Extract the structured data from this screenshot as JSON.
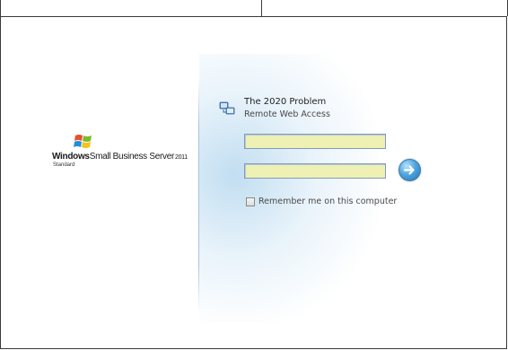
{
  "brand": {
    "name_part1": "Windows",
    "name_part2": "Small Business Server",
    "year": "2011",
    "edition": "Standard",
    "logo_icon": "windows-flag-icon"
  },
  "login": {
    "app_icon": "remote-web-access-icon",
    "site_title": "The 2020 Problem",
    "site_subtitle": "Remote Web Access",
    "username_value": "",
    "password_value": "",
    "submit_icon": "arrow-right-icon",
    "remember_label": "Remember me on this computer",
    "remember_checked": false
  },
  "colors": {
    "field_background": "#eef0b4",
    "field_border": "#7f9db9",
    "button_blue": "#4fa6de",
    "panel_glow": "#dcecf8"
  }
}
